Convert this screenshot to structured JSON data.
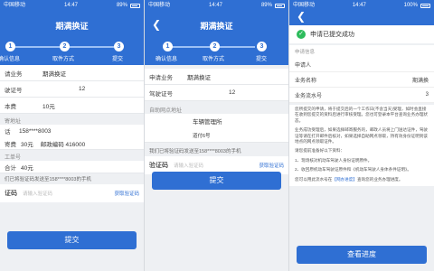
{
  "status": {
    "left1": "中国移动",
    "time1": "14:47",
    "batt1": "89%",
    "left2": "中国移动",
    "time2": "14:47",
    "batt2": "89%",
    "left3": "中国移动",
    "time3": "14:47",
    "batt3": "100%"
  },
  "screen1": {
    "title": "期满换证",
    "steps": [
      "确认信息",
      "取件方式",
      "提交"
    ],
    "step_nums": [
      "1",
      "2",
      "3"
    ],
    "rows": [
      {
        "k": "请业务",
        "v": "期满换证"
      },
      {
        "k": "驶证号",
        "v": "12"
      },
      {
        "k": "本费",
        "v": "10元"
      }
    ],
    "addr_label": "寄地址",
    "phone_k": "话",
    "phone": "158****8003",
    "fee_k": "寄费",
    "fee": "30元",
    "postcode": "邮政编码 416000",
    "time_label": "工单号",
    "total_k": "合计",
    "total": "40元",
    "sms_note": "们已将验证码发送至158****8003的手机",
    "code_label": "证码",
    "code_placeholder": "请输入验证码",
    "get_code": "获取验证码",
    "submit": "提交"
  },
  "screen2": {
    "title": "期满换证",
    "steps": [
      "确认信息",
      "取件方式",
      "提交"
    ],
    "step_nums": [
      "1",
      "2",
      "3"
    ],
    "rows": [
      {
        "k": "申请业务",
        "v": "期满换证"
      },
      {
        "k": "驾驶证号",
        "v": "12"
      }
    ],
    "pickup_label": "自助网点地址",
    "place1": "车辆管理所",
    "place2": "道付6号",
    "sms_note": "我们已将验证码发送至158****8003的手机",
    "code_label": "验证码",
    "code_placeholder": "请输入验证码",
    "get_code": "获取验证码",
    "submit": "提交"
  },
  "screen3": {
    "success_text": "申请已提交成功",
    "section_label": "申请信息",
    "rows": [
      {
        "k": "申请人",
        "v": ""
      },
      {
        "k": "业务名称",
        "v": "期满换"
      },
      {
        "k": "业务流水号",
        "v": "3"
      }
    ],
    "para1": "您所提交的申请，将于提交后的一个工作日(不含当天)受理，如时会直接在收到您提交的资料后进行审核受理。您也可登录本平台查询业务办理状态。",
    "para2": "业务成功受理后，如果选择邮寄服务的，邮政人员将上门送达证件，驾驶证等请在打开邮件后核对，如果选择自助网点领取，持有效身份证明到该地点的网点领取证件。",
    "para3": "请您提前准备好以下资料：",
    "item1": "1、现场核对机动车驾驶人身份证明原件。",
    "item2": "2、收回原机动车驾驶证原件和《机动车驾驶人身体条件证明》。",
    "para4_pre": "您可以用此流水号在",
    "para4_link": "【网办进度】",
    "para4_post": "查询您的业务办理进度。",
    "view_button": "查看进度"
  }
}
